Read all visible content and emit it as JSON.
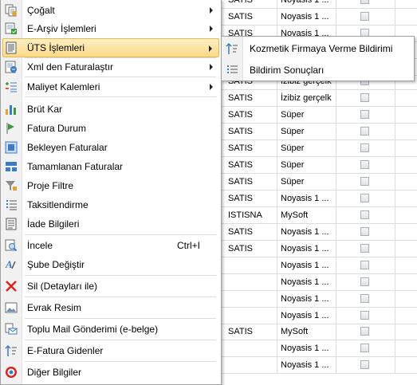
{
  "grid": {
    "rows": [
      {
        "type": "SATIS",
        "provider": "Noyasis 1 ..."
      },
      {
        "type": "SATIS",
        "provider": "Noyasis 1 ..."
      },
      {
        "type": "SATIS",
        "provider": "Noyasis 1 ..."
      },
      {
        "type": "",
        "provider": ""
      },
      {
        "type": "",
        "provider": ""
      },
      {
        "type": "SATIS",
        "provider": "İzibiz gerçelk"
      },
      {
        "type": "SATIS",
        "provider": "İzibiz gerçelk"
      },
      {
        "type": "SATIS",
        "provider": "Süper"
      },
      {
        "type": "SATIS",
        "provider": "Süper"
      },
      {
        "type": "SATIS",
        "provider": "Süper"
      },
      {
        "type": "SATIS",
        "provider": "Süper"
      },
      {
        "type": "SATIS",
        "provider": "Süper"
      },
      {
        "type": "SATIS",
        "provider": "Noyasis 1 ..."
      },
      {
        "type": "ISTISNA",
        "provider": "MySoft"
      },
      {
        "type": "SATIS",
        "provider": "Noyasis 1 ..."
      },
      {
        "type": "SATIS",
        "provider": "Noyasis 1 ..."
      },
      {
        "type": "",
        "provider": "Noyasis 1 ..."
      },
      {
        "type": "",
        "provider": "Noyasis 1 ..."
      },
      {
        "type": "",
        "provider": "Noyasis 1 ..."
      },
      {
        "type": "",
        "provider": "Noyasis 1 ..."
      },
      {
        "type": "SATIS",
        "provider": "MySoft"
      },
      {
        "type": "",
        "provider": "Noyasis 1 ..."
      },
      {
        "type": "",
        "provider": "Noyasis 1 ..."
      }
    ]
  },
  "menu": {
    "items": [
      {
        "label": "Çoğalt",
        "icon": "copy-icon",
        "submenu": true
      },
      {
        "label": "E-Arşiv İşlemleri",
        "icon": "archive-icon",
        "submenu": true
      },
      {
        "label": "ÜTS İşlemleri",
        "icon": "document-list-icon",
        "submenu": true,
        "highlighted": true
      },
      {
        "label": "Xml den Faturalaştır",
        "icon": "xml-icon",
        "submenu": true
      },
      {
        "label": "Maliyet Kalemleri",
        "icon": "cost-items-icon",
        "submenu": true
      },
      {
        "label": "Brüt Kar",
        "icon": "bar-chart-icon"
      },
      {
        "label": "Fatura Durum",
        "icon": "flag-icon"
      },
      {
        "label": "Bekleyen Faturalar",
        "icon": "pending-square-icon"
      },
      {
        "label": "Tamamlanan Faturalar",
        "icon": "grid-icon"
      },
      {
        "label": "Proje Filtre",
        "icon": "filter-icon"
      },
      {
        "label": "Taksitlendirme",
        "icon": "installment-list-icon"
      },
      {
        "label": "İade Bilgileri",
        "icon": "return-doc-icon"
      },
      {
        "label": "İncele",
        "icon": "inspect-icon",
        "shortcut": "Ctrl+I"
      },
      {
        "label": "Şube Değiştir",
        "icon": "branch-change-icon"
      },
      {
        "label": "Sil (Detayları ile)",
        "icon": "delete-icon"
      },
      {
        "label": "Evrak Resim",
        "icon": "image-icon"
      },
      {
        "label": "Toplu Mail Gönderimi (e-belge)",
        "icon": "mail-icon"
      },
      {
        "label": "E-Fatura Gidenler",
        "icon": "outgoing-sort-icon"
      },
      {
        "label": "Diğer Bilgiler",
        "icon": "other-info-icon"
      }
    ]
  },
  "submenu": {
    "items": [
      {
        "label": "Kozmetik Firmaya Verme Bildirimi",
        "icon": "sort-arrows-icon"
      },
      {
        "label": "Bildirim Sonuçları",
        "icon": "list-icon"
      }
    ]
  },
  "colors": {
    "highlight_top": "#fdf0c2",
    "highlight_bottom": "#fbd98a",
    "delete_red": "#d9261c",
    "icon_blue": "#3c7bc6"
  }
}
